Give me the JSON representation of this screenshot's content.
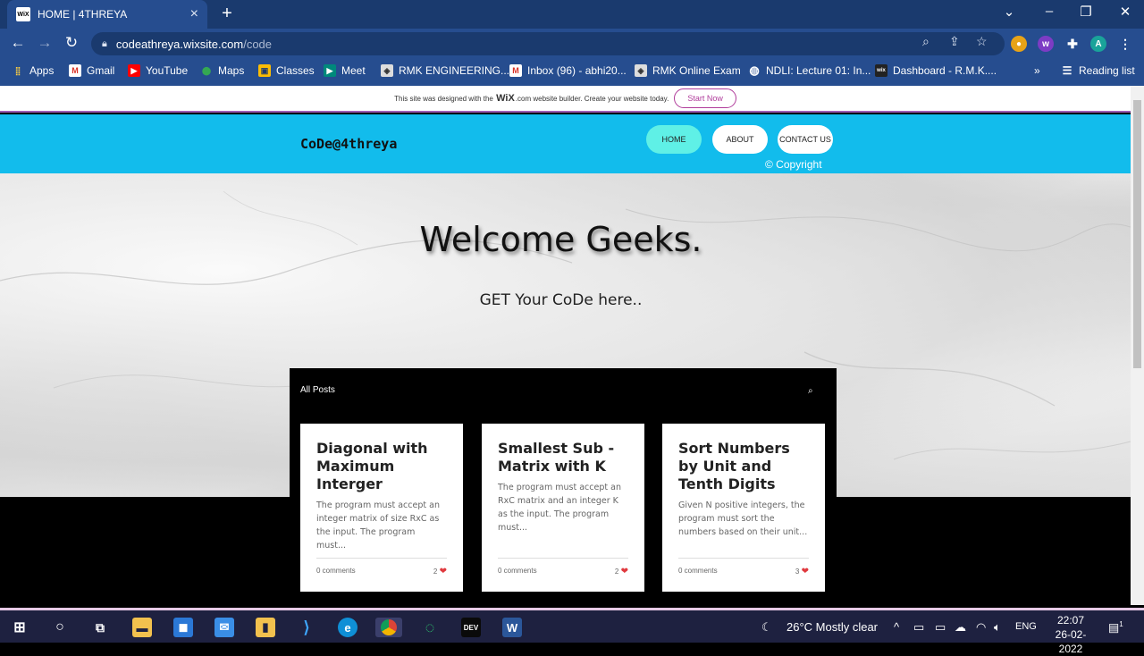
{
  "browser": {
    "tab_title": "HOME | 4THREYA",
    "tab_favicon": "WiX",
    "url_host": "codeathreya.wixsite.com",
    "url_path": "/code",
    "profile_initial": "A",
    "bookmarks": [
      "Apps",
      "Gmail",
      "YouTube",
      "Maps",
      "Classes",
      "Meet",
      "RMK ENGINEERING...",
      "Inbox (96) - abhi20...",
      "RMK Online Exam",
      "NDLI: Lecture 01: In...",
      "Dashboard - R.M.K...."
    ],
    "reading_list": "Reading list"
  },
  "wix_banner": {
    "prefix": "This site was designed with the",
    "brand": "WiX",
    "suffix": ".com website builder. Create your website today.",
    "cta": "Start Now"
  },
  "site": {
    "logo": "CoDe@4threya",
    "nav": [
      "HOME",
      "ABOUT",
      "CONTACT US"
    ],
    "copyright": "© Copyright",
    "hero_title": "Welcome Geeks.",
    "hero_subtitle": "GET Your CoDe here.."
  },
  "blog": {
    "header": "All Posts",
    "posts": [
      {
        "title": "Diagonal with Maximum Interger",
        "excerpt": "The program must accept an integer matrix of size RxC as the input. The program must...",
        "comments": "0 comments",
        "likes": "2"
      },
      {
        "title": "Smallest Sub - Matrix with K",
        "excerpt": "The program must accept an RxC matrix and an integer K as the input. The program must...",
        "comments": "0 comments",
        "likes": "2"
      },
      {
        "title": "Sort Numbers by Unit and Tenth Digits",
        "excerpt": "Given N positive integers, the program must sort the numbers based on their unit...",
        "comments": "0 comments",
        "likes": "3"
      }
    ]
  },
  "taskbar": {
    "weather": "26°C  Mostly clear",
    "lang": "ENG",
    "time": "22:07",
    "date": "26-02-2022",
    "notif_count": "1"
  },
  "colors": {
    "header": "#12bcec",
    "home_pill": "#5ff0e6",
    "wix_accent": "#b03c9b"
  }
}
